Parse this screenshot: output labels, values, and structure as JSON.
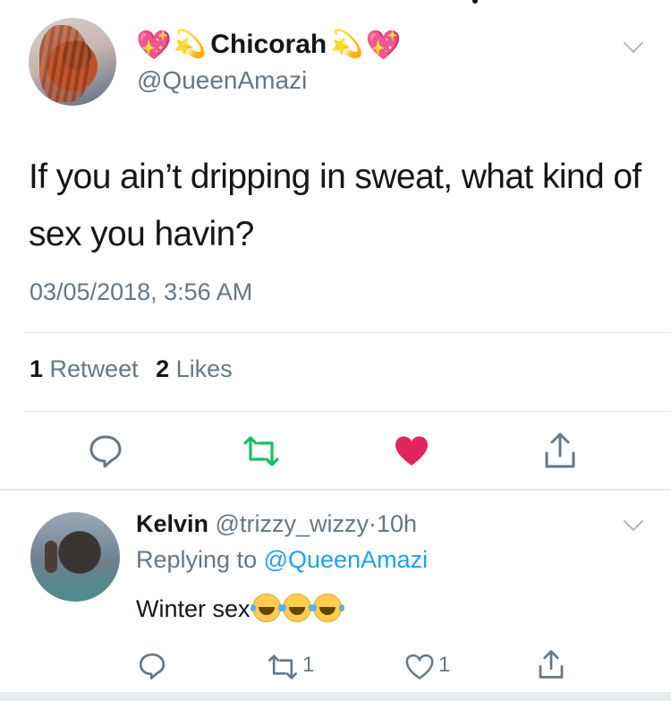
{
  "main_tweet": {
    "display_name": "Chicorah",
    "handle": "@QueenAmazi",
    "text": "If you ain’t dripping in sweat, what kind of sex you havin?",
    "timestamp": "03/05/2018, 3:56 AM",
    "retweet_count": "1",
    "retweet_label": "Retweet",
    "like_count": "2",
    "like_label": "Likes",
    "name_emojis": [
      "sparkling-heart",
      "dizzy",
      "dizzy",
      "sparkling-heart"
    ],
    "liked": true,
    "colors": {
      "like": "#e0245e",
      "retweet": "#17bf63",
      "muted": "#657786",
      "link": "#1da1f2"
    }
  },
  "reply": {
    "display_name": "Kelvin",
    "handle": "@trizzy_wizzy",
    "separator": "·",
    "time": "10h",
    "replying_label": "Replying to",
    "replying_to": "@QueenAmazi",
    "text": "Winter sex",
    "emojis": [
      "face-with-tears-of-joy",
      "face-with-tears-of-joy",
      "face-with-tears-of-joy"
    ],
    "retweet_count": "1",
    "like_count": "1"
  }
}
